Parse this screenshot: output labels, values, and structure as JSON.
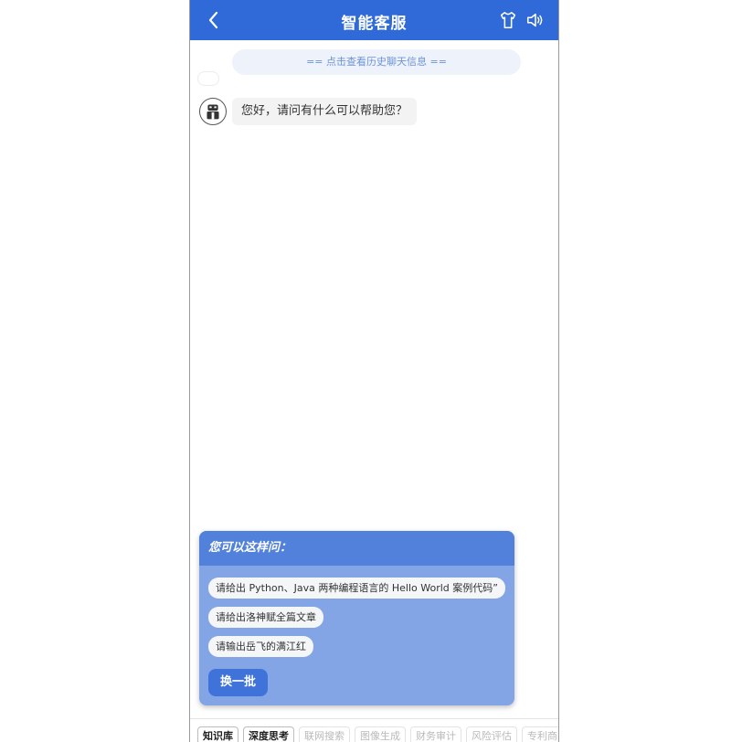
{
  "header": {
    "title": "智能客服",
    "back_icon": "chevron-left-icon",
    "theme_icon": "tshirt-icon",
    "speaker_icon": "speaker-icon",
    "bg_color": "#2f6ad8"
  },
  "history": {
    "label": "== 点击查看历史聊天信息 =="
  },
  "chat": {
    "bot_avatar_icon": "robot-icon",
    "greeting": "您好，请问有什么可以帮助您？"
  },
  "suggestions": {
    "title": "您可以这样问：",
    "items": [
      "请给出 Python、Java 两种编程语言的 Hello World 案例代码”",
      "请给出洛神赋全篇文章",
      "请输出岳飞的满江红"
    ],
    "refresh_label": "换一批"
  },
  "toolbar": {
    "tools": [
      {
        "label": "知识库",
        "active": true
      },
      {
        "label": "深度思考",
        "active": true
      },
      {
        "label": "联网搜索",
        "active": false
      },
      {
        "label": "图像生成",
        "active": false
      },
      {
        "label": "财务审计",
        "active": false
      },
      {
        "label": "风险评估",
        "active": false
      },
      {
        "label": "专利商",
        "active": false
      }
    ]
  }
}
